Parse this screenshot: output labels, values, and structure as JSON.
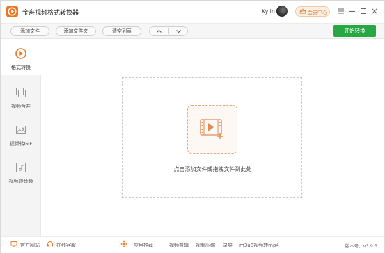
{
  "app": {
    "title": "金舟视频格式转换器",
    "user_name": "Kylin",
    "member_label": "会员中心"
  },
  "toolbar": {
    "add_file_label": "添加文件",
    "add_folder_label": "添加文件夹",
    "clear_list_label": "清空列表",
    "start_label": "开始转换"
  },
  "sidebar": {
    "items": [
      {
        "label": "格式转换",
        "icon": "format-convert-icon"
      },
      {
        "label": "视频合并",
        "icon": "video-merge-icon"
      },
      {
        "label": "视频转GIF",
        "icon": "video-to-gif-icon"
      },
      {
        "label": "视频转音频",
        "icon": "video-to-audio-icon"
      }
    ]
  },
  "main": {
    "drop_hint": "点击添加文件或拖拽文件到此处"
  },
  "footer": {
    "website_label": "官方网站",
    "support_label": "在线客服",
    "recommend_label": "「应用推荐」",
    "links": [
      "视频剪辑",
      "视频压缩",
      "录屏",
      "m3u8视频转mp4"
    ],
    "version": "版本号：v3.9.3"
  },
  "colors": {
    "accent_orange": "#f0741f",
    "start_green": "#27a845",
    "drop_border": "#e3a57c"
  }
}
